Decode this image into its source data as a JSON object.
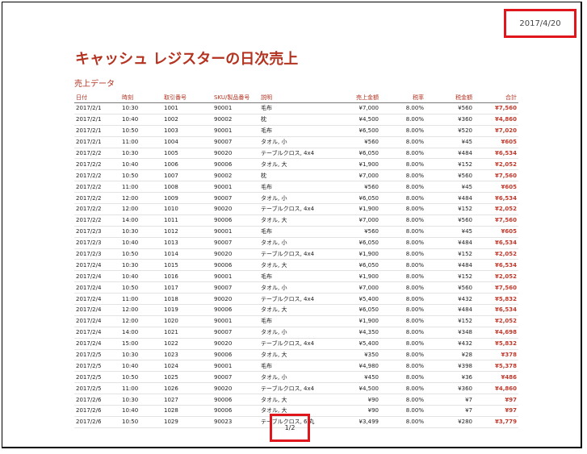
{
  "header": {
    "date": "2017/4/20"
  },
  "report": {
    "title": "キャッシュ レジスターの日次売上",
    "subtitle": "売上データ"
  },
  "table": {
    "columns": [
      "日付",
      "時刻",
      "取引番号",
      "SKU/製品番号",
      "説明",
      "売上金額",
      "税率",
      "税金額",
      "合計"
    ],
    "rows": [
      [
        "2017/2/1",
        "10:30",
        "1001",
        "90001",
        "毛布",
        "¥7,000",
        "8.00%",
        "¥560",
        "¥7,560"
      ],
      [
        "2017/2/1",
        "10:40",
        "1002",
        "90002",
        "枕",
        "¥4,500",
        "8.00%",
        "¥360",
        "¥4,860"
      ],
      [
        "2017/2/1",
        "10:50",
        "1003",
        "90001",
        "毛布",
        "¥6,500",
        "8.00%",
        "¥520",
        "¥7,020"
      ],
      [
        "2017/2/1",
        "11:00",
        "1004",
        "90007",
        "タオル, 小",
        "¥560",
        "8.00%",
        "¥45",
        "¥605"
      ],
      [
        "2017/2/2",
        "10:30",
        "1005",
        "90020",
        "テーブルクロス, 4x4",
        "¥6,050",
        "8.00%",
        "¥484",
        "¥6,534"
      ],
      [
        "2017/2/2",
        "10:40",
        "1006",
        "90006",
        "タオル, 大",
        "¥1,900",
        "8.00%",
        "¥152",
        "¥2,052"
      ],
      [
        "2017/2/2",
        "10:50",
        "1007",
        "90002",
        "枕",
        "¥7,000",
        "8.00%",
        "¥560",
        "¥7,560"
      ],
      [
        "2017/2/2",
        "11:00",
        "1008",
        "90001",
        "毛布",
        "¥560",
        "8.00%",
        "¥45",
        "¥605"
      ],
      [
        "2017/2/2",
        "12:00",
        "1009",
        "90007",
        "タオル, 小",
        "¥6,050",
        "8.00%",
        "¥484",
        "¥6,534"
      ],
      [
        "2017/2/2",
        "12:00",
        "1010",
        "90020",
        "テーブルクロス, 4x4",
        "¥1,900",
        "8.00%",
        "¥152",
        "¥2,052"
      ],
      [
        "2017/2/2",
        "14:00",
        "1011",
        "90006",
        "タオル, 大",
        "¥7,000",
        "8.00%",
        "¥560",
        "¥7,560"
      ],
      [
        "2017/2/3",
        "10:30",
        "1012",
        "90001",
        "毛布",
        "¥560",
        "8.00%",
        "¥45",
        "¥605"
      ],
      [
        "2017/2/3",
        "10:40",
        "1013",
        "90007",
        "タオル, 小",
        "¥6,050",
        "8.00%",
        "¥484",
        "¥6,534"
      ],
      [
        "2017/2/3",
        "10:50",
        "1014",
        "90020",
        "テーブルクロス, 4x4",
        "¥1,900",
        "8.00%",
        "¥152",
        "¥2,052"
      ],
      [
        "2017/2/4",
        "10:30",
        "1015",
        "90006",
        "タオル, 大",
        "¥6,050",
        "8.00%",
        "¥484",
        "¥6,534"
      ],
      [
        "2017/2/4",
        "10:40",
        "1016",
        "90001",
        "毛布",
        "¥1,900",
        "8.00%",
        "¥152",
        "¥2,052"
      ],
      [
        "2017/2/4",
        "10:50",
        "1017",
        "90007",
        "タオル, 小",
        "¥7,000",
        "8.00%",
        "¥560",
        "¥7,560"
      ],
      [
        "2017/2/4",
        "11:00",
        "1018",
        "90020",
        "テーブルクロス, 4x4",
        "¥5,400",
        "8.00%",
        "¥432",
        "¥5,832"
      ],
      [
        "2017/2/4",
        "12:00",
        "1019",
        "90006",
        "タオル, 大",
        "¥6,050",
        "8.00%",
        "¥484",
        "¥6,534"
      ],
      [
        "2017/2/4",
        "12:00",
        "1020",
        "90001",
        "毛布",
        "¥1,900",
        "8.00%",
        "¥152",
        "¥2,052"
      ],
      [
        "2017/2/4",
        "14:00",
        "1021",
        "90007",
        "タオル, 小",
        "¥4,350",
        "8.00%",
        "¥348",
        "¥4,698"
      ],
      [
        "2017/2/4",
        "15:00",
        "1022",
        "90020",
        "テーブルクロス, 4x4",
        "¥5,400",
        "8.00%",
        "¥432",
        "¥5,832"
      ],
      [
        "2017/2/5",
        "10:30",
        "1023",
        "90006",
        "タオル, 大",
        "¥350",
        "8.00%",
        "¥28",
        "¥378"
      ],
      [
        "2017/2/5",
        "10:40",
        "1024",
        "90001",
        "毛布",
        "¥4,980",
        "8.00%",
        "¥398",
        "¥5,378"
      ],
      [
        "2017/2/5",
        "10:50",
        "1025",
        "90007",
        "タオル, 小",
        "¥450",
        "8.00%",
        "¥36",
        "¥486"
      ],
      [
        "2017/2/5",
        "11:00",
        "1026",
        "90020",
        "テーブルクロス, 4x4",
        "¥4,500",
        "8.00%",
        "¥360",
        "¥4,860"
      ],
      [
        "2017/2/6",
        "10:30",
        "1027",
        "90006",
        "タオル, 大",
        "¥90",
        "8.00%",
        "¥7",
        "¥97"
      ],
      [
        "2017/2/6",
        "10:40",
        "1028",
        "90006",
        "タオル, 大",
        "¥90",
        "8.00%",
        "¥7",
        "¥97"
      ],
      [
        "2017/2/6",
        "10:50",
        "1029",
        "90023",
        "テーブルクロス, 6'丸",
        "¥3,499",
        "8.00%",
        "¥280",
        "¥3,779"
      ]
    ]
  },
  "footer": {
    "page": "1/2"
  }
}
